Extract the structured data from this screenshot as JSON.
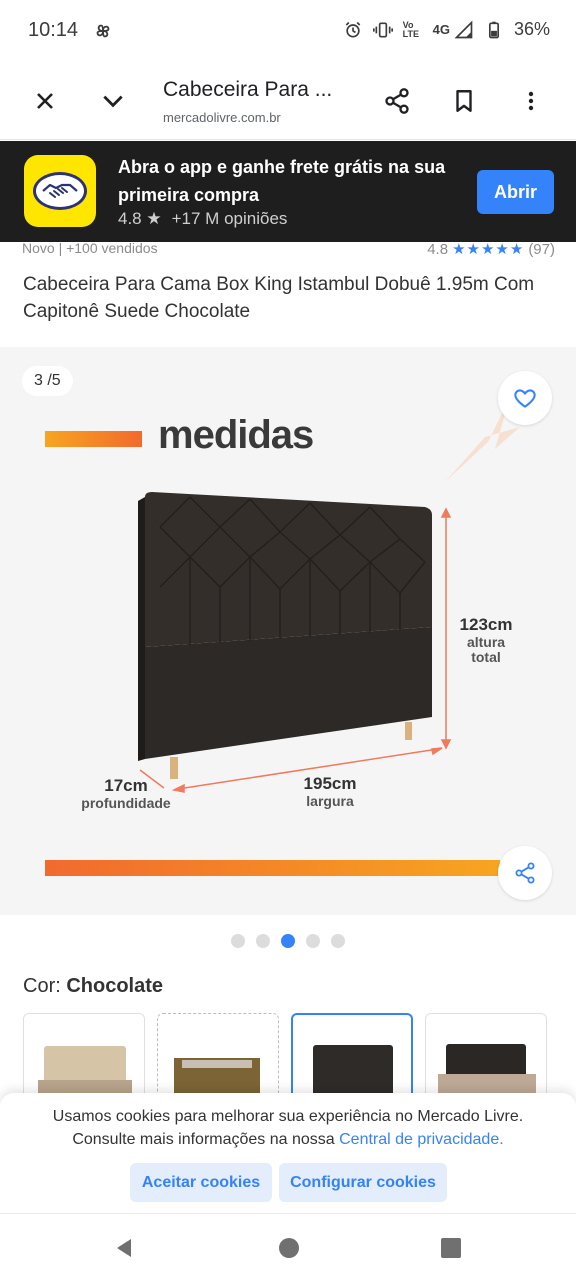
{
  "status_bar": {
    "time": "10:14",
    "battery": "36%",
    "network": "4G",
    "volte": "Vo LTE",
    "icons": [
      "pinwheel-icon",
      "alarm-icon",
      "vibrate-icon",
      "volte-icon",
      "signal-icon",
      "battery-icon"
    ]
  },
  "browser": {
    "title": "Cabeceira Para ...",
    "url": "mercadolivre.com.br"
  },
  "app_banner": {
    "headline": "Abra o app e ganhe frete grátis na sua primeira compra",
    "rating": "4.8",
    "reviews": "+17 M opiniões",
    "button": "Abrir",
    "brand_color": "#ffe600"
  },
  "product": {
    "condition": "Novo | +100 vendidos",
    "rating": "4.8",
    "stars": "★★★★★",
    "rating_count": "(97)",
    "title": "Cabeceira Para Cama Box King Istambul Dobuê 1.95m Com Capitonê Suede Chocolate"
  },
  "gallery": {
    "counter": "3 /5",
    "image_heading": "medidas",
    "height_value": "123cm",
    "height_label_1": "altura",
    "height_label_2": "total",
    "depth_value": "17cm",
    "depth_label": "profundidade",
    "width_value": "195cm",
    "width_label": "largura",
    "total_images": 5,
    "active_image": 3
  },
  "color": {
    "label": "Cor: ",
    "value": "Chocolate"
  },
  "cookie": {
    "line1": "Usamos cookies para melhorar sua experiência no Mercado Livre.",
    "line2_prefix": "Consulte mais informações na nossa ",
    "privacy_link": "Central de privacidade.",
    "accept": "Aceitar cookies",
    "configure": "Configurar cookies"
  },
  "colors": {
    "accent": "#3483fa",
    "banner_bg": "#1e1e1e",
    "gallery_bg": "#f5f5f5"
  }
}
